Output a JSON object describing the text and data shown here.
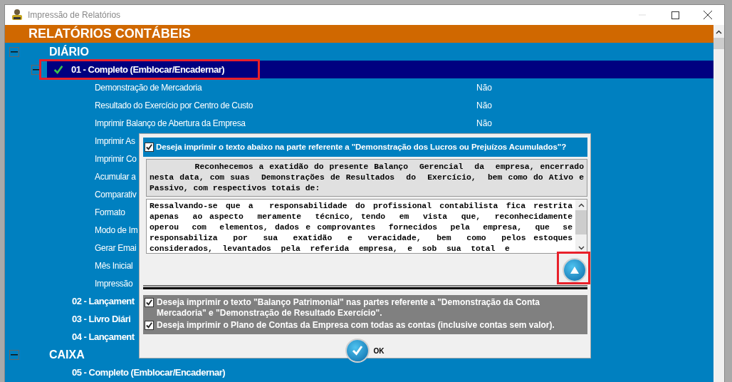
{
  "window": {
    "title": "Impressão de Relatórios"
  },
  "header": {
    "title": "RELATÓRIOS CONTÁBEIS"
  },
  "sections": [
    {
      "label": "DIÁRIO",
      "expanded": true,
      "reports": [
        {
          "label": "01 - Completo (Emblocar/Encadernar)",
          "selected": true,
          "checked": true,
          "expanded": true,
          "highlighted": true,
          "options": [
            {
              "label": "Demonstração de Mercadoria",
              "value": "Não"
            },
            {
              "label": "Resultado do Exercício por Centro de Custo",
              "value": "Não"
            },
            {
              "label": "Imprimir Balanço de Abertura da Empresa",
              "value": "Não"
            },
            {
              "label": "Imprimir As"
            },
            {
              "label": "Imprimir Co"
            },
            {
              "label": "Acumular a"
            },
            {
              "label": "Comparativ"
            },
            {
              "label": "Formato"
            },
            {
              "label": "Modo de Im"
            },
            {
              "label": "Gerar Emai"
            },
            {
              "label": "Mês Inicial"
            },
            {
              "label": "Impressão"
            }
          ]
        },
        {
          "label": "02 - Lançament",
          "selected": false,
          "checked": false,
          "expanded": false,
          "highlighted": false
        },
        {
          "label": "03 - Livro Diári",
          "selected": false,
          "checked": false,
          "expanded": false,
          "highlighted": false
        },
        {
          "label": "04 - Lançament",
          "selected": false,
          "checked": false,
          "expanded": false,
          "highlighted": false
        }
      ]
    },
    {
      "label": "CAIXA",
      "expanded": true,
      "reports": [
        {
          "label": "05 - Completo (Emblocar/Encadernar)",
          "selected": false,
          "checked": false,
          "expanded": false,
          "highlighted": false
        }
      ]
    }
  ],
  "dialog": {
    "top_option": {
      "label": "Deseja imprimir o texto abaixo na parte referente a \"Demonstração dos Lucros ou Prejuízos Acumulados\"?",
      "checked": true
    },
    "header_text": "        Reconhecemos a exatidão do presente Balanço  Gerencial  da  empresa, encerrado nesta data, com suas  Demonstrações de Resultados  do  Exercício,  bem como do Ativo e Passivo, com respectivos totais de:",
    "body_text": "Ressalvando-se que a  responsabilidade do profissional contabilista fica restrita apenas  ao aspecto  meramente  técnico, tendo  em  vista  que,  reconhecidamente operou  com  elementos, dados e comprovantes  fornecidos  pela  empresa,  que  se responsabiliza  por  sua  exatidão  e  veracidade,  bem  como  pelos estoques considerados,  levantados  pela  referida  empresa,  e  sob  sua  total  e",
    "scroll_button": {
      "highlighted": true
    },
    "options": [
      {
        "label": "Deseja imprimir o texto \"Balanço Patrimonial\" nas partes referente a \"Demonstração da Conta Mercadoria\" e \"Demonstração de Resultado Exercício\".",
        "checked": true
      },
      {
        "label": "Deseja imprimir o Plano de Contas da Empresa com todas as contas (inclusive contas sem valor).",
        "checked": true
      }
    ],
    "ok_label": "OK"
  }
}
